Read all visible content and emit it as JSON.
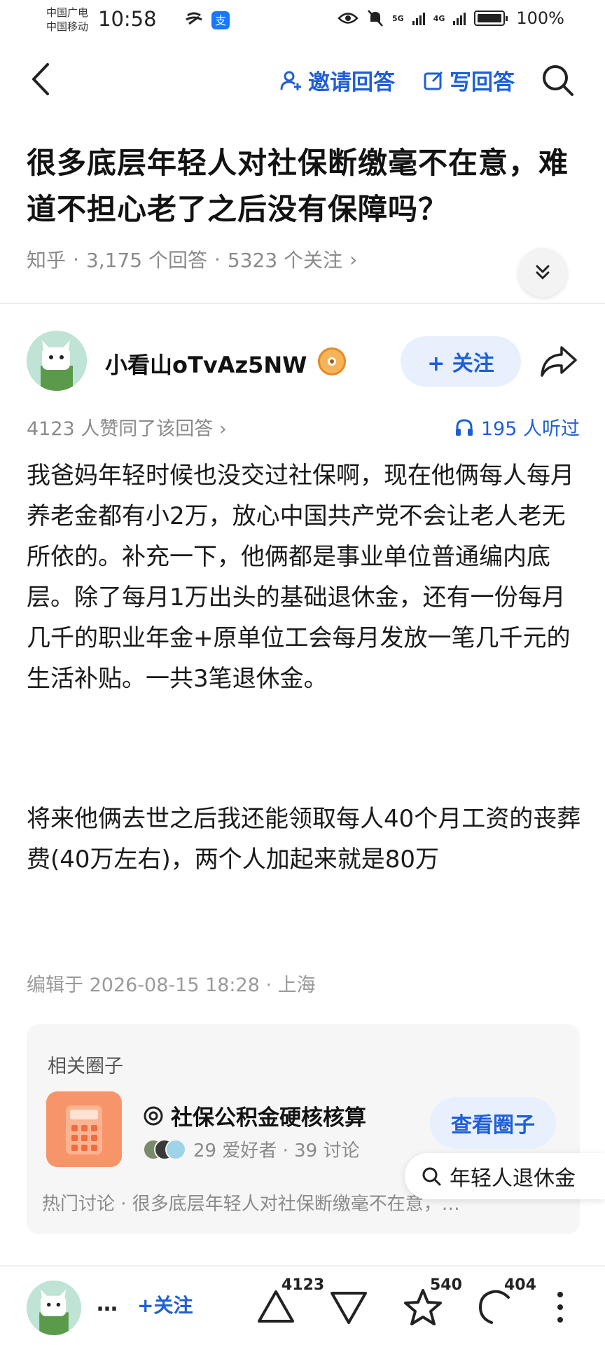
{
  "status_bar": {
    "carrier_1": "中国广电",
    "carrier_2": "中国移动",
    "time": "10:58",
    "network_1": "5G",
    "network_2": "4G",
    "battery": "100%"
  },
  "nav": {
    "invite_answer": "邀请回答",
    "write_answer": "写回答"
  },
  "question": {
    "title": "很多底层年轻人对社保断缴毫不在意，难道不担心老了之后没有保障吗？",
    "source": "知乎",
    "answers": "3,175 个回答",
    "follows": "5323 个关注",
    "meta_chevron": "›",
    "sep": "·"
  },
  "author": {
    "name": "小看山oTvAz5NW",
    "follow_label": "+ 关注"
  },
  "stats": {
    "approvals": "4123 人赞同了该回答 ›",
    "listens": "195 人听过"
  },
  "answer": {
    "paragraph_1": "我爸妈年轻时候也没交过社保啊，现在他俩每人每月养老金都有小2万，放心中国共产党不会让老人老无所依的。补充一下，他俩都是事业单位普通编内底层。除了每月1万出头的基础退休金，还有一份每月几千的职业年金+原单位工会每月发放一笔几千元的生活补贴。一共3笔退休金。",
    "paragraph_2": "将来他俩去世之后我还能领取每人40个月工资的丧葬费(40万左右)，两个人加起来就是80万",
    "edited": "编辑于 2026-08-15 18:28 · 上海"
  },
  "circle": {
    "section_title": "相关圈子",
    "name": "社保公积金硬核核算",
    "members": "29 爱好者 · 39 讨论",
    "view_button": "查看圈子",
    "hot_label": "热门讨论 · 很多底层年轻人对社保断缴毫不在意，…"
  },
  "search_suggestion": "年轻人退休金",
  "bottom_bar": {
    "dots": "…",
    "follow_label": "+关注",
    "upvotes": "4123",
    "favorites": "540",
    "comments": "404"
  },
  "colors": {
    "accent": "#1f5fd6",
    "accent_bg": "#e8f0fd",
    "muted": "#8a8a8a"
  }
}
